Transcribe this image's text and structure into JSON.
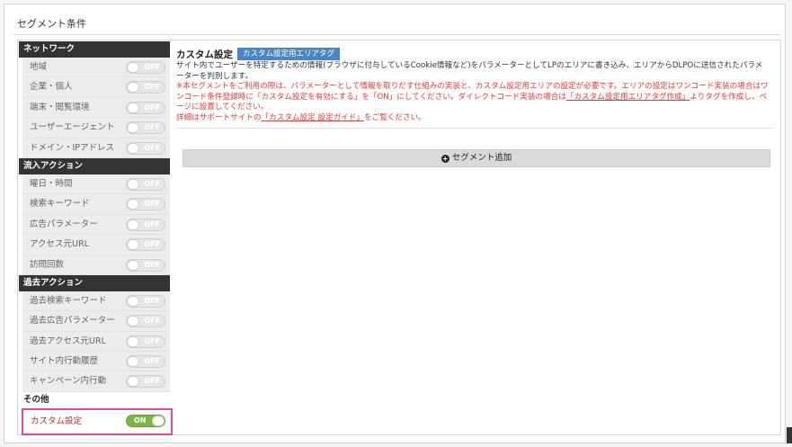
{
  "panel": {
    "title": "セグメント条件"
  },
  "sidebar": {
    "sections": [
      {
        "heading": "ネットワーク",
        "items": [
          {
            "label": "地域",
            "state": "OFF"
          },
          {
            "label": "企業・個人",
            "state": "OFF"
          },
          {
            "label": "端末・閲覧環境",
            "state": "OFF"
          },
          {
            "label": "ユーザーエージェント",
            "state": "OFF"
          },
          {
            "label": "ドメイン・IPアドレス",
            "state": "OFF"
          }
        ]
      },
      {
        "heading": "流入アクション",
        "items": [
          {
            "label": "曜日・時間",
            "state": "OFF"
          },
          {
            "label": "検索キーワード",
            "state": "OFF"
          },
          {
            "label": "広告パラメーター",
            "state": "OFF"
          },
          {
            "label": "アクセス元URL",
            "state": "OFF"
          },
          {
            "label": "訪問回数",
            "state": "OFF"
          }
        ]
      },
      {
        "heading": "過去アクション",
        "items": [
          {
            "label": "過去検索キーワード",
            "state": "OFF"
          },
          {
            "label": "過去広告パラメーター",
            "state": "OFF"
          },
          {
            "label": "過去アクセス元URL",
            "state": "OFF"
          },
          {
            "label": "サイト内行動履歴",
            "state": "OFF"
          },
          {
            "label": "キャンペーン内行動",
            "state": "OFF"
          }
        ]
      },
      {
        "heading": "その他",
        "items": [
          {
            "label": "カスタム設定",
            "state": "ON"
          }
        ]
      }
    ]
  },
  "content": {
    "title": "カスタム設定",
    "tag": "カスタム設定用エリアタグ",
    "description": "サイト内でユーザーを特定するための情報(ブラウザに付与しているCookie情報など)をパラメーターとしてLPのエリアに書き込み、エリアからDLPOに送信されたパラメーターを判別します。",
    "warning_part1": "※本セグメントをご利用の際は、パラメーターとして情報を取りだす仕組みの実装と、カスタム設定用エリアの設定が必要です。エリアの設定はワンコード実装の場合はワンコード条件登録時に「カスタム設定を有効にする」を「ON」にしてください。ダイレクトコード実装の場合は",
    "warning_link": "「カスタム設定用エリアタグ作成」",
    "warning_part2": "よりタグを作成し、ページに設置してください。",
    "note_part1": "詳細はサポートサイトの",
    "note_link": "「カスタム設定 設定ガイド」",
    "note_part2": "をご覧ください。",
    "add_button": "セグメント追加"
  },
  "colors": {
    "accent_tag": "#4a86c5",
    "toggle_on": "#7cb342",
    "warning": "#e53935",
    "highlight": "#e04aa0"
  }
}
